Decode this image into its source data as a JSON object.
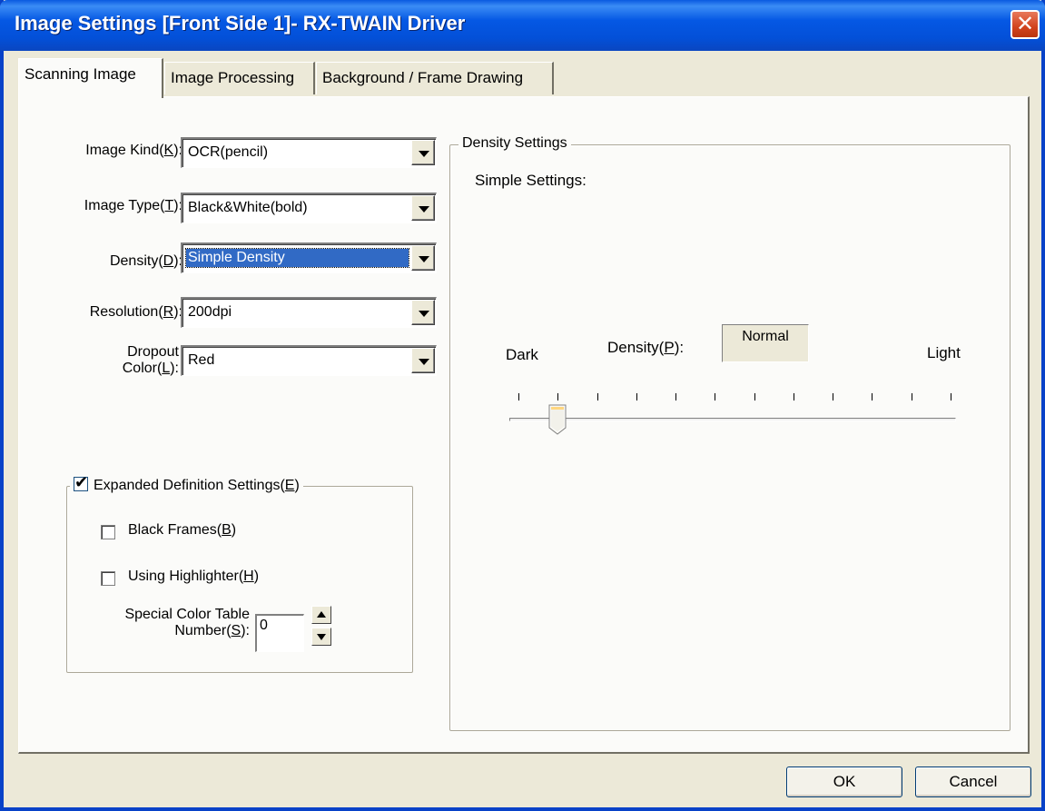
{
  "window": {
    "title": "Image Settings [Front Side 1]- RX-TWAIN Driver",
    "close_glyph": "✕"
  },
  "tabs": [
    {
      "label": "Scanning Image",
      "active": true
    },
    {
      "label": "Image Processing",
      "active": false
    },
    {
      "label": "Background / Frame Drawing",
      "active": false
    }
  ],
  "form": {
    "image_kind": {
      "label": "Image Kind(",
      "hotkey": "K",
      "label_end": "):",
      "value": "OCR(pencil)"
    },
    "image_type": {
      "label": "Image Type(",
      "hotkey": "T",
      "label_end": "):",
      "value": "Black&White(bold)"
    },
    "density": {
      "label": "Density(",
      "hotkey": "D",
      "label_end": "):",
      "value": "Simple Density"
    },
    "resolution": {
      "label": "Resolution(",
      "hotkey": "R",
      "label_end": "):",
      "value": "200dpi"
    },
    "dropout": {
      "label_line1": "Dropout",
      "label_line2": "Color(",
      "hotkey": "L",
      "label_end": "):",
      "value": "Red"
    }
  },
  "expanded": {
    "label": "Expanded Definition Settings(",
    "hotkey": "E",
    "label_end": ")",
    "checked": true,
    "black_frames": {
      "label": "Black Frames(",
      "hotkey": "B",
      "label_end": ")",
      "checked": false
    },
    "highlighter": {
      "label": "Using Highlighter(",
      "hotkey": "H",
      "label_end": ")",
      "checked": false
    },
    "color_table": {
      "label_line1": "Special Color Table",
      "label_line2": "Number(",
      "hotkey": "S",
      "label_end": "):",
      "value": "0"
    }
  },
  "density_settings": {
    "legend": "Density Settings",
    "simple_label": "Simple Settings:",
    "dark_label": "Dark",
    "light_label": "Light",
    "density_label": "Density(",
    "density_hotkey": "P",
    "density_label_end": "):",
    "density_value": "Normal",
    "slider": {
      "min": 0,
      "max": 11,
      "value": 1
    }
  },
  "buttons": {
    "ok": "OK",
    "cancel": "Cancel"
  },
  "colors": {
    "titlebar": "#0558e4",
    "selection": "#316ac5",
    "face": "#ece9d8"
  }
}
